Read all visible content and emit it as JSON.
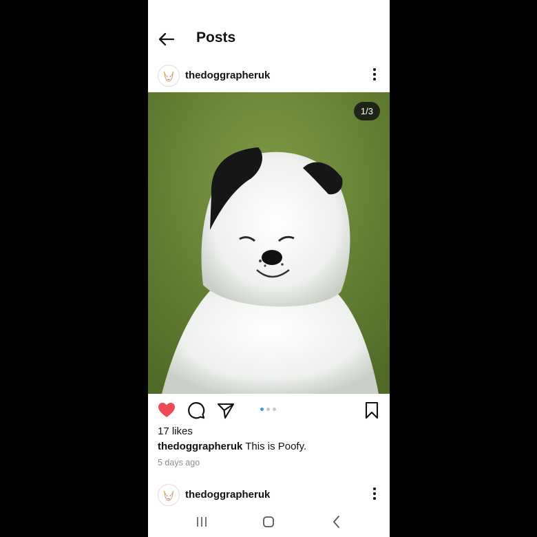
{
  "header": {
    "title": "Posts",
    "back_icon": "arrow-left-icon"
  },
  "post": {
    "username": "thedoggrapheruk",
    "image_counter": "1/3",
    "carousel": {
      "current": 1,
      "total": 3
    },
    "liked": true,
    "likes": "17 likes",
    "caption_user": "thedoggrapheruk",
    "caption_text": " This is Poofy.",
    "time": "5 days ago"
  },
  "next_post": {
    "username": "thedoggrapheruk"
  },
  "colors": {
    "like": "#ed4956",
    "dot_active": "#3897f0",
    "dot_inactive": "#c8c8c8"
  },
  "system_nav": {
    "icons": [
      "recent-apps-icon",
      "home-icon",
      "back-icon"
    ]
  }
}
